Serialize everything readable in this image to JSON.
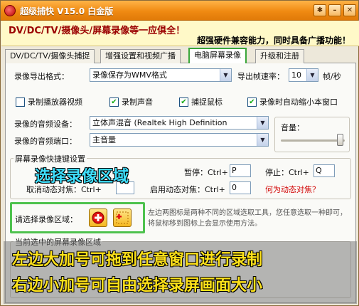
{
  "window": {
    "title": "超级捕快 V15.0 白金版",
    "buttons": {
      "settings": "✱",
      "minimize": "–",
      "close": "✕"
    }
  },
  "header": {
    "slogan1": "DV/DC/TV/摄像头/屏幕录像等一应俱全！",
    "slogan2": "超强硬件兼容能力，同时具备广播功能！"
  },
  "tabs": [
    {
      "label": "DV/DC/TV/摄像头捕捉"
    },
    {
      "label": "增强设置和视频广播"
    },
    {
      "label": "电脑屏幕录像"
    },
    {
      "label": "升级和注册"
    }
  ],
  "export": {
    "format_label": "录像导出格式：",
    "format_value": "录像保存为WMV格式",
    "fps_label": "导出帧速率：",
    "fps_value": "10",
    "fps_unit": "帧/秒"
  },
  "options": {
    "record_player": "录制播放器视频",
    "record_sound": "录制声音",
    "capture_mouse": "捕捉鼠标",
    "auto_minimize": "录像时自动缩小本窗口"
  },
  "audio": {
    "device_label": "录像的音频设备：",
    "device_value": "立体声混音 (Realtek High Definition",
    "port_label": "录像的音频端口：",
    "port_value": "主音量",
    "volume_label": "音量：",
    "volume_level": 0.92
  },
  "hotkeys": {
    "group_title": "屏幕录像快捷键设置",
    "pause_label": "暂停：Ctrl+",
    "pause_key": "P",
    "stop_label": "停止：Ctrl+",
    "stop_key": "Q",
    "cancel_label": "取消动态对焦：Ctrl+",
    "cancel_key": "",
    "dynamic_label": "启用动态对焦：Ctrl+",
    "dynamic_key": "0",
    "dynamic_link": "何为动态对焦？"
  },
  "region": {
    "label": "请选择录像区域：",
    "help": "左边两图标是两种不同的区域选取工具，您任意选取一种即可，将鼠标移到图标上会显示使用方法。",
    "current_title": "当前选中的屏幕录像区域"
  },
  "overlays": {
    "select_region": "选择录像区域",
    "line1": "左边大加号可拖到任意窗口进行录制",
    "line2": "右边小加号可自由选择录屏画面大小"
  },
  "colors": {
    "accent_green": "#4ec24e",
    "title_orange": "#f08a12",
    "overlay_yellow": "#ffe21a",
    "overlay_cyan": "#3fe0ff"
  }
}
